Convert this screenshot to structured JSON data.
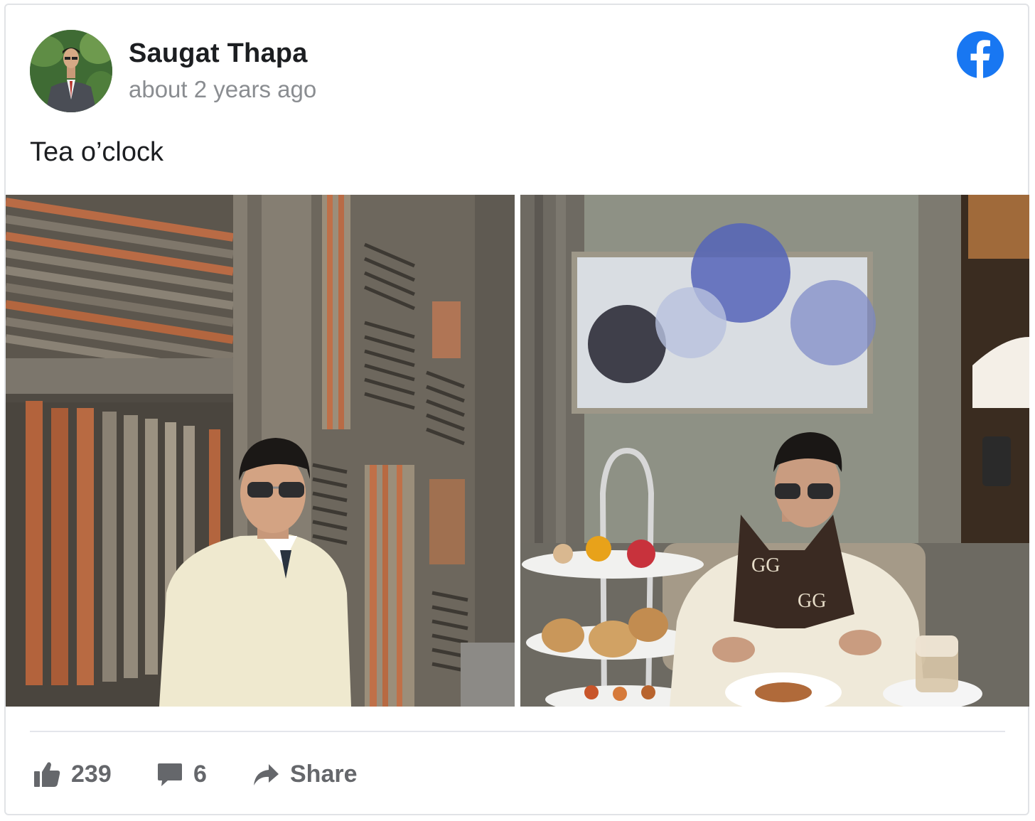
{
  "post": {
    "author": "Saugat Thapa",
    "timestamp": "about 2 years ago",
    "text": "Tea o’clock",
    "platform_icon": "facebook-icon",
    "brand_color": "#1877f2"
  },
  "photos": [
    {
      "alt_icon": "photo-man-by-wooden-louvers"
    },
    {
      "alt_icon": "photo-man-at-afternoon-tea"
    }
  ],
  "actions": {
    "likes": "239",
    "comments": "6",
    "share_label": "Share",
    "like_icon": "thumbs-up-icon",
    "comment_icon": "comment-icon",
    "share_icon": "share-arrow-icon"
  }
}
